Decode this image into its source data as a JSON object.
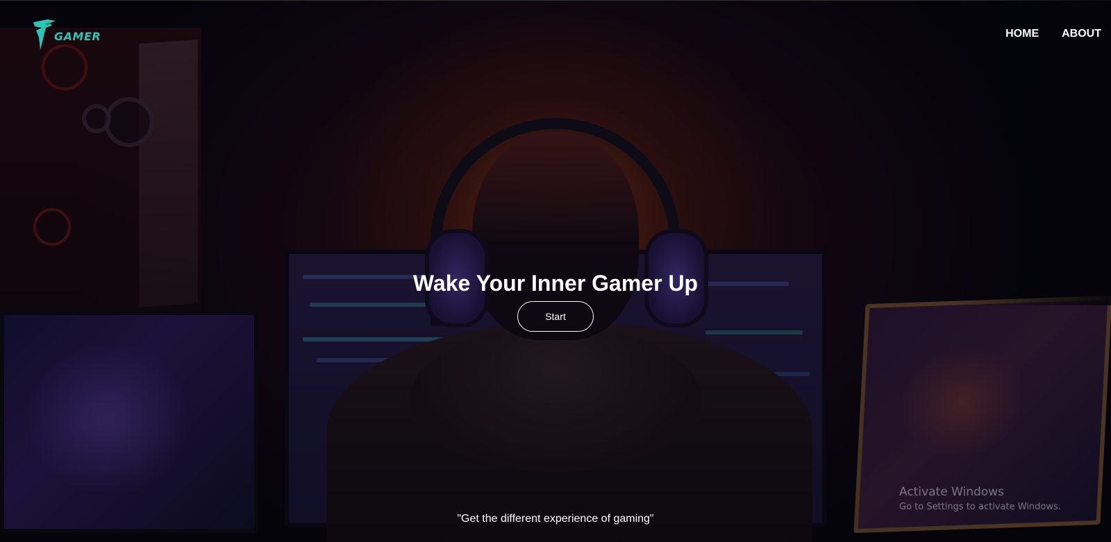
{
  "brand": {
    "logo_text": "GAMER"
  },
  "nav": {
    "items": [
      {
        "label": "HOME"
      },
      {
        "label": "ABOUT"
      }
    ]
  },
  "hero": {
    "title": "Wake Your Inner Gamer Up",
    "start_label": "Start",
    "tagline": "\"Get the different experience of gaming\""
  },
  "watermark": {
    "title": "Activate Windows",
    "subtitle": "Go to Settings to activate Windows."
  },
  "colors": {
    "accent": "#2cc4b5",
    "text": "#ffffff"
  },
  "icons": {
    "logo": "dragon-logo-icon"
  }
}
